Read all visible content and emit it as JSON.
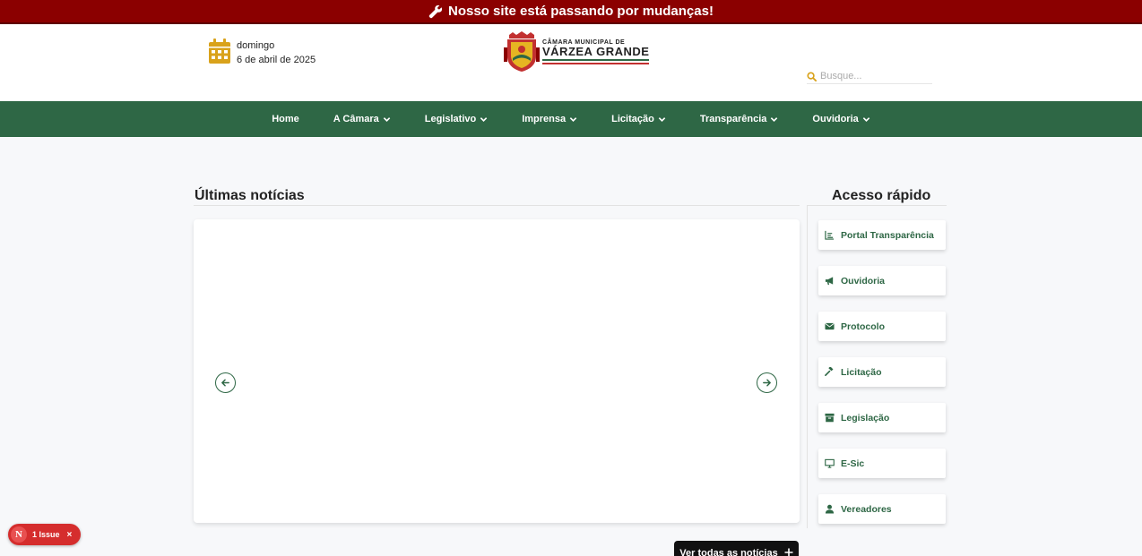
{
  "banner": {
    "text": "Nosso site está passando por mudanças!"
  },
  "header": {
    "day_name": "domingo",
    "date": "6 de abril de 2025",
    "logo_line1": "CÂMARA MUNICIPAL DE",
    "logo_line2": "VÁRZEA GRANDE",
    "search_placeholder": "Busque..."
  },
  "nav": {
    "items": [
      {
        "label": "Home",
        "dropdown": false
      },
      {
        "label": "A Câmara",
        "dropdown": true
      },
      {
        "label": "Legislativo",
        "dropdown": true
      },
      {
        "label": "Imprensa",
        "dropdown": true
      },
      {
        "label": "Licitação",
        "dropdown": true
      },
      {
        "label": "Transparência",
        "dropdown": true
      },
      {
        "label": "Ouvidoria",
        "dropdown": true
      }
    ]
  },
  "news": {
    "title": "Últimas notícias",
    "see_all": "Ver todas as notícias",
    "see_all_icon": "plus-icon"
  },
  "quick_access": {
    "title": "Acesso rápido",
    "items": [
      {
        "label": "Portal Transparência",
        "icon": "chart-icon"
      },
      {
        "label": "Ouvidoria",
        "icon": "megaphone-icon"
      },
      {
        "label": "Protocolo",
        "icon": "envelope-icon"
      },
      {
        "label": "Licitação",
        "icon": "gavel-icon"
      },
      {
        "label": "Legislação",
        "icon": "archive-icon"
      },
      {
        "label": "E-Sic",
        "icon": "monitor-icon"
      },
      {
        "label": "Vereadores",
        "icon": "user-icon"
      }
    ]
  },
  "issue_badge": {
    "letter": "N",
    "text": "1 Issue",
    "close": "×"
  },
  "colors": {
    "banner": "#8b0000",
    "nav": "#2e6745",
    "accent_gold": "#d9a21b"
  }
}
